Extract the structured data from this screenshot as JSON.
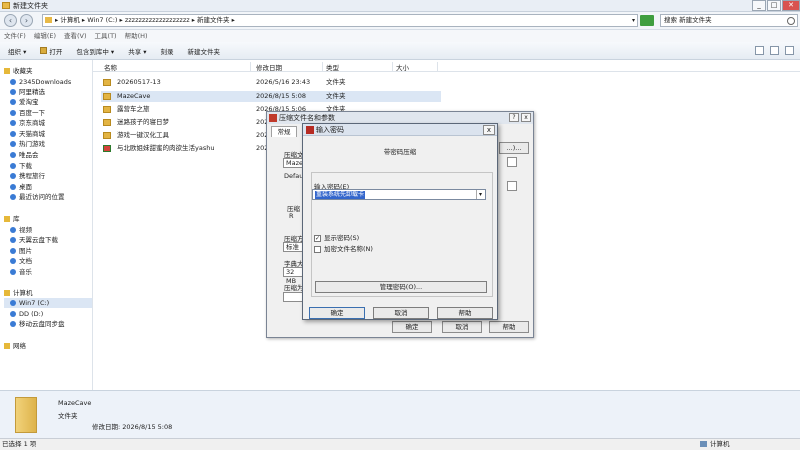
{
  "window": {
    "title": "新建文件夹",
    "controls": [
      "_",
      "□",
      "✕"
    ]
  },
  "address": {
    "path": "▸ 计算机 ▸ Win7 (C:) ▸ zzzzzzzzzzzzzzzzzzz ▸ 新建文件夹 ▸",
    "search_placeholder": "搜索 新建文件夹"
  },
  "menubar": [
    "文件(F)",
    "编辑(E)",
    "查看(V)",
    "工具(T)",
    "帮助(H)"
  ],
  "toolbar": {
    "organize": "组织 ▾",
    "open": "打开",
    "include": "包含到库中 ▾",
    "share": "共享 ▾",
    "burn": "刻录",
    "new_folder": "新建文件夹"
  },
  "nav": {
    "favorites_header": "收藏夹",
    "favorites": [
      "2345Downloads",
      "阿里精选",
      "爱淘宝",
      "百度一下",
      "京东商城",
      "天猫商城",
      "热门游戏",
      "唯品会",
      "下载",
      "携程旅行",
      "桌面",
      "最近访问的位置"
    ],
    "libraries_header": "库",
    "libraries": [
      "视频",
      "天翼云盘下载",
      "图片",
      "文档",
      "音乐"
    ],
    "computer_header": "计算机",
    "computer": [
      "Win7 (C:)",
      "DD (D:)",
      "移动云盘同步盘"
    ],
    "network": "网络"
  },
  "columns": {
    "name": "名称",
    "date": "修改日期",
    "type": "类型",
    "size": "大小"
  },
  "files": [
    {
      "name": "20260517-13",
      "date": "2026/5/16 23:43",
      "type": "文件夹"
    },
    {
      "name": "MazeCave",
      "date": "2026/8/15 5:08",
      "type": "文件夹"
    },
    {
      "name": "露营车之旅",
      "date": "2026/8/15 5:06",
      "type": "文件夹"
    },
    {
      "name": "迷路孩子的寝日梦",
      "date": "202",
      "type": ""
    },
    {
      "name": "游戏一键汉化工具",
      "date": "202",
      "type": ""
    },
    {
      "name": "与北欧姐妹甜蜜的肉欲生活yashu",
      "date": "202",
      "type": ""
    }
  ],
  "details": {
    "name": "MazeCave",
    "type": "文件夹",
    "modified": "修改日期: 2026/8/15 5:08"
  },
  "status": {
    "left": "已选择 1 项",
    "right": "计算机"
  },
  "archive_dialog": {
    "title": "压缩文件名和参数",
    "tab": "常规",
    "label_name": "压缩文",
    "name_value": "MazeC",
    "label_default": "Defau",
    "label_format": "压缩",
    "format_value": "R",
    "label_method": "压缩方",
    "method_value": "标准",
    "label_dict": "字典大",
    "dict_value": "32 MB",
    "label_split": "压缩为",
    "btn_settings": "...)...",
    "btn_ok": "确定",
    "btn_cancel": "取消",
    "btn_help": "帮助",
    "title_help": "?",
    "title_close": "x"
  },
  "password_dialog": {
    "title": "输入密码",
    "close": "x",
    "header": "带密码压缩",
    "label_password": "输入密码(E)",
    "password_value": "重装系统先卸载卡",
    "dropdown": "▾",
    "show_password": "显示密码(S)",
    "show_password_checked": true,
    "encrypt_names": "加密文件名称(N)",
    "encrypt_names_checked": false,
    "manage_button": "管理密码(O)...",
    "ok": "确定",
    "cancel": "取消",
    "help": "帮助"
  }
}
